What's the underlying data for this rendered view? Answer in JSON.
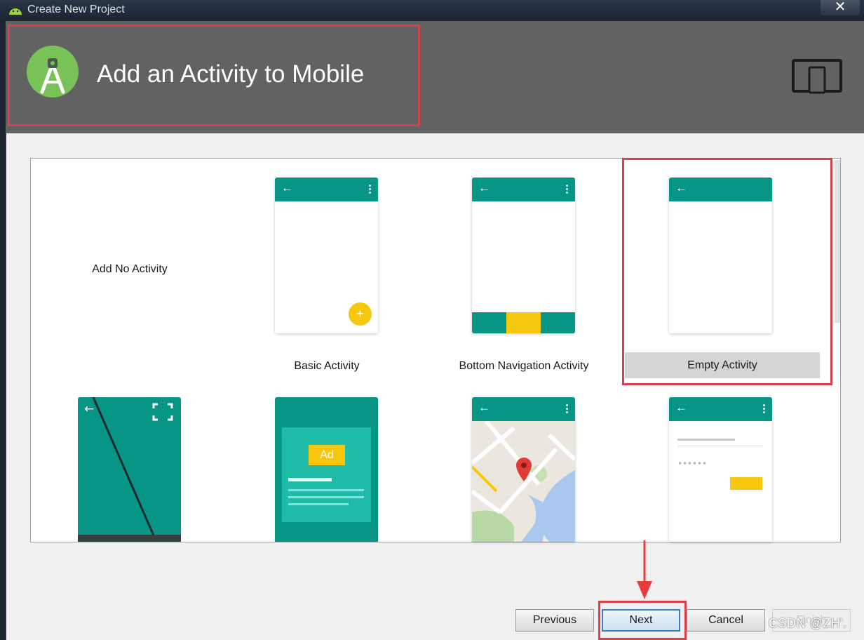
{
  "window": {
    "title": "Create New Project",
    "close_glyph": "✕"
  },
  "header": {
    "title": "Add an Activity to Mobile",
    "logo_icon": "android-studio-logo",
    "form_factor_icon": "phone-tablet-icon"
  },
  "gallery": {
    "tiles": [
      {
        "label": "Add No Activity"
      },
      {
        "label": "Basic Activity"
      },
      {
        "label": "Bottom Navigation Activity"
      },
      {
        "label": "Empty Activity",
        "selected": true
      }
    ],
    "second_row": {
      "ad_label": "Ad"
    }
  },
  "buttons": {
    "previous": "Previous",
    "next": "Next",
    "cancel": "Cancel",
    "finish": "Finish"
  },
  "watermark": "CSDN @ZH'.",
  "colors": {
    "header_bg": "#626262",
    "teal": "#079685",
    "accent_yellow": "#f7c60f",
    "highlight_red": "#d8404a"
  }
}
